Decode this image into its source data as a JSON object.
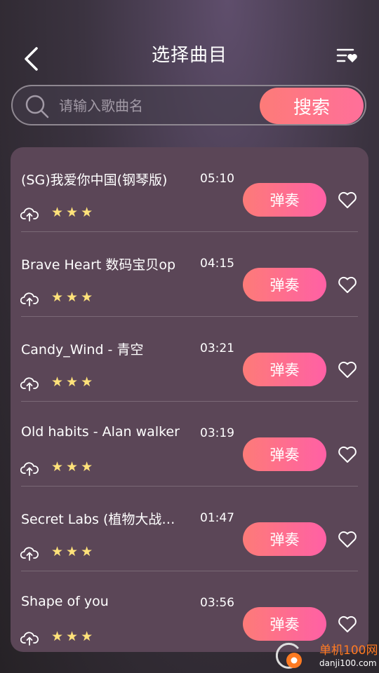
{
  "header": {
    "title": "选择曲目",
    "back_icon": "chevron-left-icon",
    "playlist_icon": "playlist-heart-icon"
  },
  "search": {
    "placeholder": "请输入歌曲名",
    "value": "",
    "button_label": "搜索",
    "icon": "search-icon"
  },
  "songs": [
    {
      "name": "(SG)我爱你中国(钢琴版)",
      "duration": "05:10",
      "stars": 3,
      "action_label": "弹奏"
    },
    {
      "name": "Brave Heart 数码宝贝op",
      "duration": "04:15",
      "stars": 3,
      "action_label": "弹奏"
    },
    {
      "name": "Candy_Wind - 青空",
      "duration": "03:21",
      "stars": 3,
      "action_label": "弹奏"
    },
    {
      "name": "Old habits - Alan walker",
      "duration": "03:19",
      "stars": 3,
      "action_label": "弹奏"
    },
    {
      "name": "Secret Labs (植物大战…",
      "duration": "01:47",
      "stars": 3,
      "action_label": "弹奏"
    },
    {
      "name": "Shape of you",
      "duration": "03:56",
      "stars": 3,
      "action_label": "弹奏"
    }
  ],
  "watermark": {
    "text": "单机100网",
    "domain": "danji100.com"
  },
  "colors": {
    "accent_start": "#fd7b78",
    "accent_end": "#ff60a5",
    "panel": "#5b4657",
    "star": "#ffe27a"
  }
}
